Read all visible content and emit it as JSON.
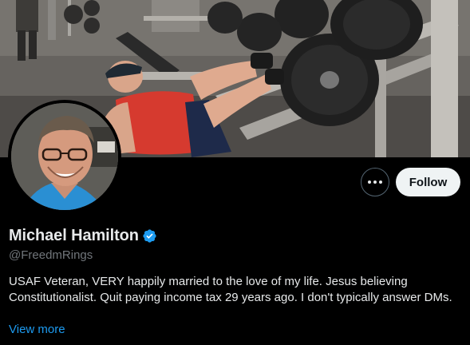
{
  "profile": {
    "display_name": "Michael Hamilton",
    "handle": "@FreedmRings",
    "bio": "USAF Veteran, VERY happily married to the love of my life. Jesus believing Constitutionalist. Quit paying income tax 29 years ago. I don't typically answer DMs.",
    "view_more_label": "View more",
    "verified": true
  },
  "actions": {
    "follow_label": "Follow",
    "more_icon": "more-horizontal-icon"
  },
  "colors": {
    "background": "#000000",
    "verified_blue": "#1d9bf0",
    "follow_button_bg": "#eff3f4",
    "link_blue": "#1d9bf0"
  }
}
